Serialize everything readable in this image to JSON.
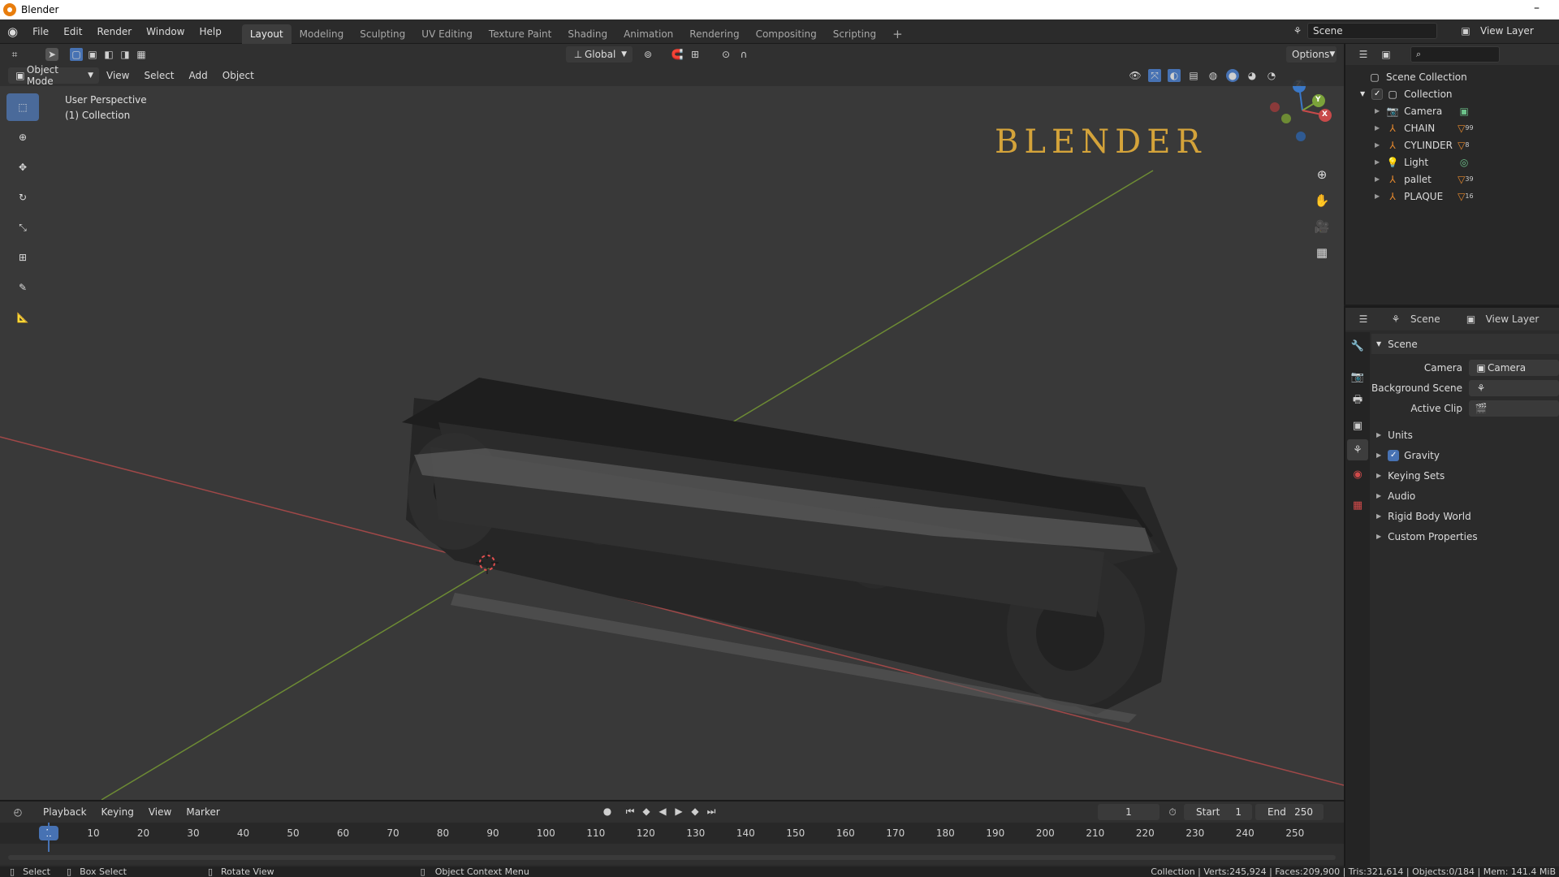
{
  "window": {
    "title": "Blender",
    "minimize": "–"
  },
  "menu": [
    "File",
    "Edit",
    "Render",
    "Window",
    "Help"
  ],
  "workspaces": [
    "Layout",
    "Modeling",
    "Sculpting",
    "UV Editing",
    "Texture Paint",
    "Shading",
    "Animation",
    "Rendering",
    "Compositing",
    "Scripting"
  ],
  "add_workspace": "+",
  "scene_field": "Scene",
  "view_layer_field": "View Layer",
  "transform_orientation": "Global",
  "options_label": "Options",
  "viewport": {
    "mode": "Object Mode",
    "menus": [
      "View",
      "Select",
      "Add",
      "Object"
    ],
    "info_line1": "User Perspective",
    "info_line2": "(1) Collection",
    "watermark": "BLENDER",
    "gizmo_axes": [
      "Z",
      "Y",
      "X"
    ]
  },
  "outliner": {
    "root": "Scene Collection",
    "collection": "Collection",
    "items": [
      {
        "name": "Camera",
        "icon": "camera-icon",
        "extra": "camera-data"
      },
      {
        "name": "CHAIN",
        "icon": "empty-icon",
        "extra": "99"
      },
      {
        "name": "CYLINDER",
        "icon": "empty-icon",
        "extra": "8"
      },
      {
        "name": "Light",
        "icon": "light-icon",
        "extra": "light-data"
      },
      {
        "name": "pallet",
        "icon": "empty-icon",
        "extra": "39"
      },
      {
        "name": "PLAQUE",
        "icon": "empty-icon",
        "extra": "16"
      }
    ]
  },
  "properties": {
    "header_scene": "Scene",
    "header_view_layer": "View Layer",
    "panel_title": "Scene",
    "camera_label": "Camera",
    "camera_value": "Camera",
    "bg_scene_label": "Background Scene",
    "active_clip_label": "Active Clip",
    "subpanels": [
      "Units",
      "Gravity",
      "Keying Sets",
      "Audio",
      "Rigid Body World",
      "Custom Properties"
    ],
    "gravity_checked": true
  },
  "timeline": {
    "menus": [
      "Playback",
      "Keying",
      "View",
      "Marker"
    ],
    "current_frame": "1",
    "start_label": "Start",
    "start_value": "1",
    "end_label": "End",
    "end_value": "250",
    "ruler": [
      "10",
      "20",
      "30",
      "40",
      "50",
      "60",
      "70",
      "80",
      "90",
      "100",
      "110",
      "120",
      "130",
      "140",
      "150",
      "160",
      "170",
      "180",
      "190",
      "200",
      "210",
      "220",
      "230",
      "240",
      "250"
    ],
    "playhead": "1"
  },
  "statusbar": {
    "select": "Select",
    "box_select": "Box Select",
    "rotate_view": "Rotate View",
    "context_menu": "Object Context Menu",
    "stats": "Collection | Verts:245,924 | Faces:209,900 | Tris:321,614 | Objects:0/184 | Mem: 141.4 MiB"
  },
  "colors": {
    "accent": "#4772b3",
    "watermark": "#d4a33a",
    "x_axis": "#c84a4a",
    "y_axis": "#7ba33a",
    "z_axis": "#3a78c8"
  }
}
